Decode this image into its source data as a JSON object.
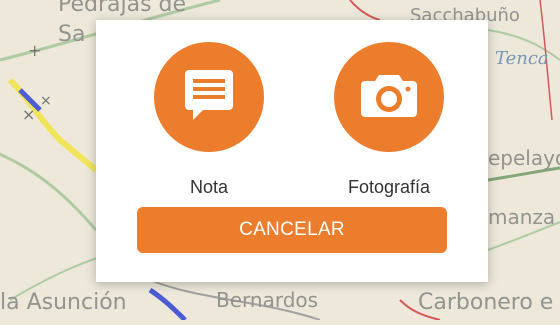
{
  "map": {
    "labels": {
      "top_left": "Pedrajas de",
      "left_fragment": "Sa",
      "top_right": "Sacchabuño",
      "river": "Tenca",
      "right_mid": "epelayo",
      "right_lower": "manza",
      "bottom_left": "la Asunción",
      "bottom_mid": "Bernardos",
      "bottom_right": "Carbonero e"
    }
  },
  "dialog": {
    "options": [
      {
        "label": "Nota",
        "icon": "note-icon"
      },
      {
        "label": "Fotografía",
        "icon": "camera-icon"
      }
    ],
    "cancel_label": "CANCELAR"
  },
  "colors": {
    "accent": "#ec7d2d",
    "dialog_bg": "#ffffff",
    "label_text": "#333333"
  }
}
